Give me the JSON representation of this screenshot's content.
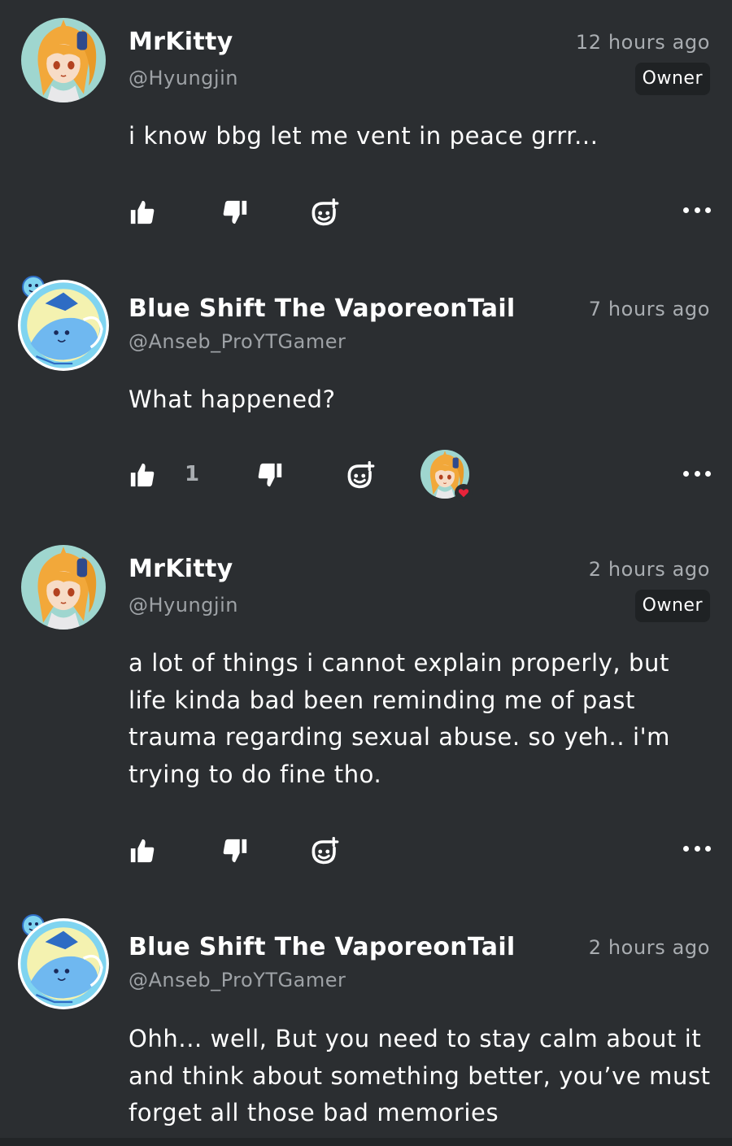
{
  "comments": [
    {
      "display_name": "MrKitty",
      "handle": "@Hyungjin",
      "timestamp": "12 hours ago",
      "role": "Owner",
      "body": "i know bbg let me vent in peace grrr...",
      "avatar": "orange-hair-anime-avatar",
      "likes": null,
      "reactions": []
    },
    {
      "display_name": "Blue Shift The VaporeonTail",
      "handle": "@Anseb_ProYTGamer",
      "timestamp": "7 hours ago",
      "role": null,
      "body": "What happened?",
      "avatar": "vaporeon-avatar",
      "likes": "1",
      "reactions": [
        "orange-hair-anime-avatar-heart"
      ]
    },
    {
      "display_name": "MrKitty",
      "handle": "@Hyungjin",
      "timestamp": "2 hours ago",
      "role": "Owner",
      "body": "a lot of things i cannot explain properly, but life kinda bad been reminding me of past trauma regarding sexual abuse. so yeh.. i'm trying to do fine tho.",
      "avatar": "orange-hair-anime-avatar",
      "likes": null,
      "reactions": []
    },
    {
      "display_name": "Blue Shift The VaporeonTail",
      "handle": "@Anseb_ProYTGamer",
      "timestamp": "2 hours ago",
      "role": null,
      "body": "Ohh... well, But you need to stay calm about it and think about something better, you’ve must forget all those bad memories",
      "avatar": "vaporeon-avatar",
      "likes": null,
      "reactions": []
    }
  ],
  "icons": {
    "like": "thumbs-up-icon",
    "dislike": "thumbs-down-icon",
    "react": "add-reaction-icon",
    "more": "more-options-icon",
    "heart": "heart-icon"
  },
  "colors": {
    "background": "#2b2e31",
    "text": "#ffffff",
    "muted": "#a9adb1",
    "badge_bg": "#1f2224",
    "heart": "#e8233a"
  }
}
